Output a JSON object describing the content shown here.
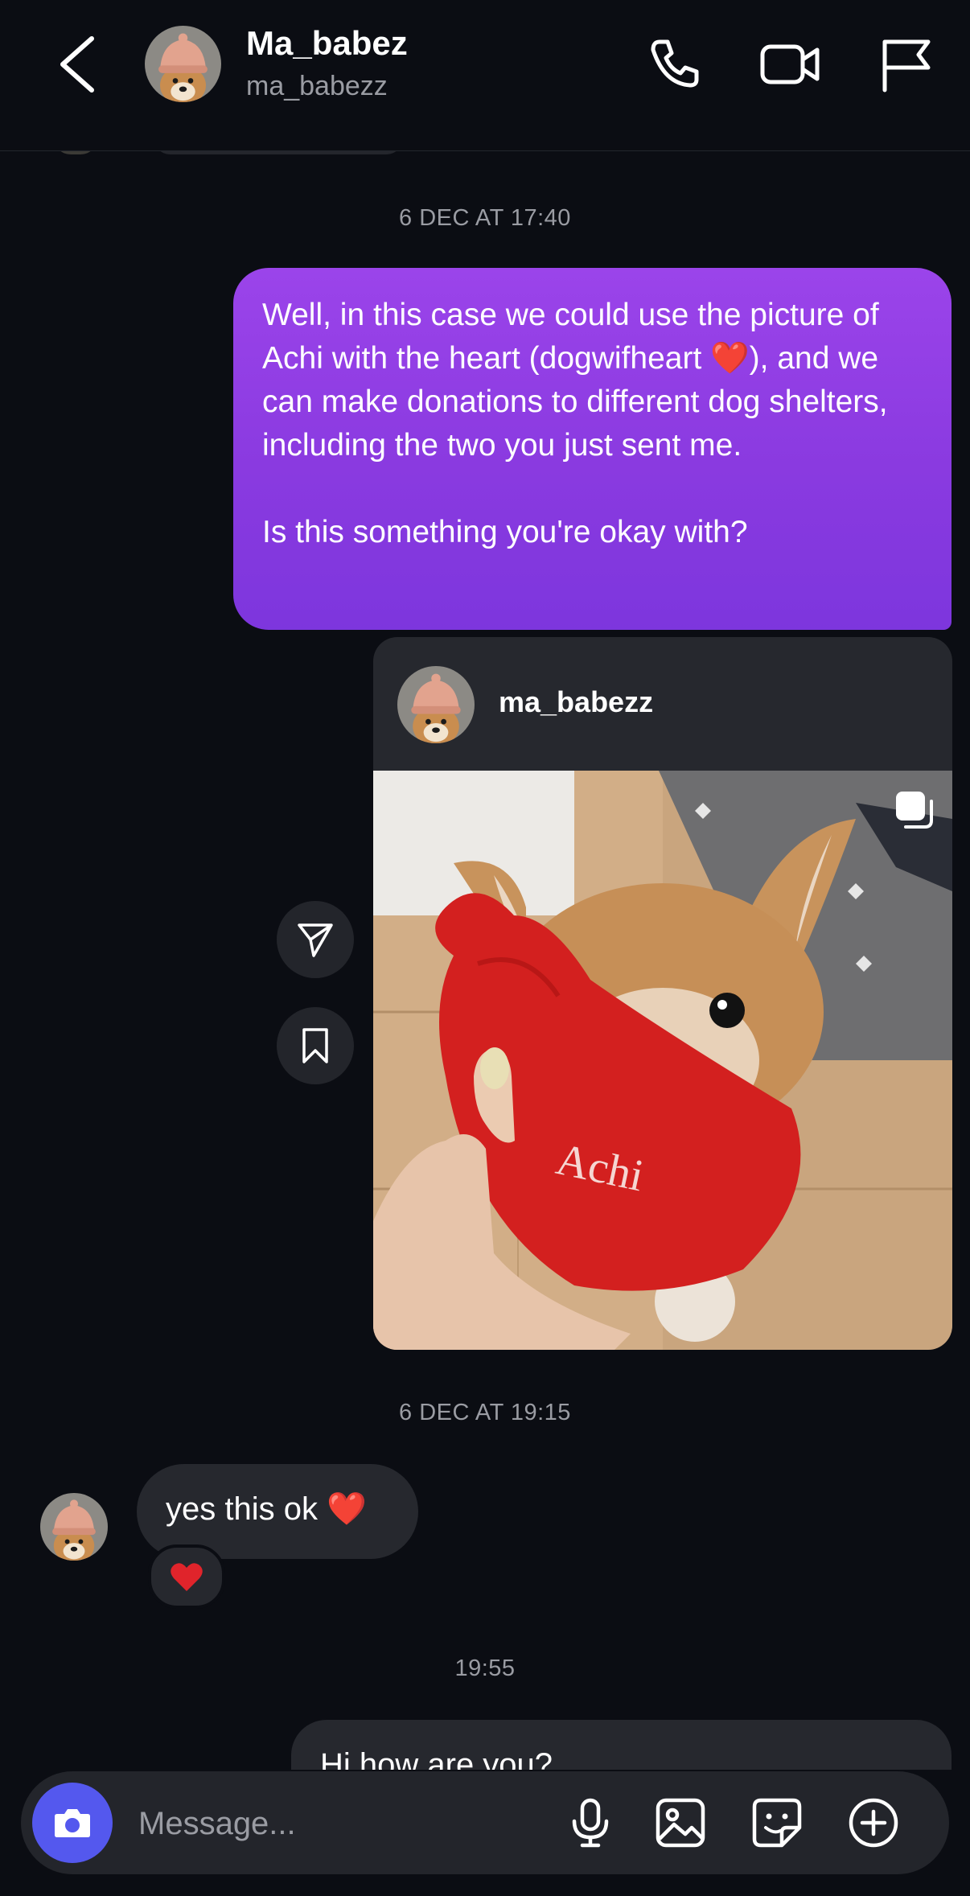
{
  "header": {
    "name": "Ma_babez",
    "handle": "ma_babezz",
    "icons": [
      "back-icon",
      "phone-icon",
      "video-icon",
      "flag-icon"
    ]
  },
  "timestamps": [
    "6 DEC AT 17:40",
    "6 DEC AT 19:15",
    "19:55"
  ],
  "outgoing_message": {
    "text": "Well, in this case we could use the picture of Achi with the heart (dogwifheart ❤️), and we can make donations to different dog shelters, including the two you just sent me.\n\nIs this something you're okay with?"
  },
  "shared_post": {
    "username": "ma_babezz",
    "image_caption_text": "Achi"
  },
  "incoming_message": {
    "text": "yes this ok ❤️",
    "reaction": "❤️"
  },
  "partial_message": {
    "text": "Hi how are you?"
  },
  "composer": {
    "placeholder": "Message...",
    "icons": [
      "camera-icon",
      "mic-icon",
      "gallery-icon",
      "sticker-icon",
      "add-icon"
    ]
  },
  "colors": {
    "background": "#0b0d13",
    "bubble_outgoing": "#8a3ae0",
    "bubble_incoming": "#26282e",
    "camera_button": "#5458ee"
  }
}
